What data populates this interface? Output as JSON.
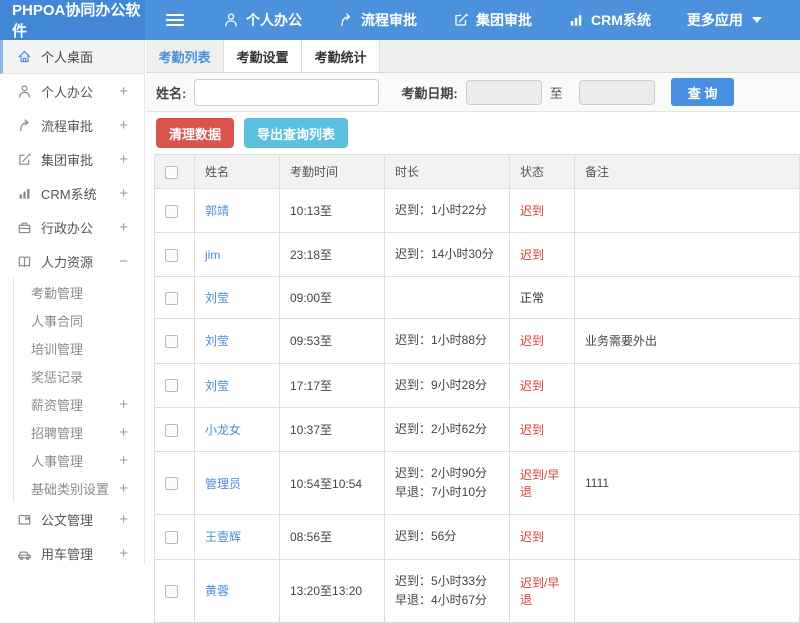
{
  "header": {
    "logo": "PHPOA协同办公软件",
    "nav": [
      {
        "label": "个人办公",
        "icon": "person-icon"
      },
      {
        "label": "流程审批",
        "icon": "flow-icon"
      },
      {
        "label": "集团审批",
        "icon": "edit-icon"
      },
      {
        "label": "CRM系统",
        "icon": "chart-icon"
      },
      {
        "label": "更多应用",
        "icon": "caret-down-icon"
      }
    ]
  },
  "sidebar": {
    "items": [
      {
        "label": "个人桌面",
        "icon": "home-icon",
        "active": true,
        "expand": ""
      },
      {
        "label": "个人办公",
        "icon": "person-icon",
        "expand": "+"
      },
      {
        "label": "流程审批",
        "icon": "flow-icon",
        "expand": "+"
      },
      {
        "label": "集团审批",
        "icon": "edit-icon",
        "expand": "+"
      },
      {
        "label": "CRM系统",
        "icon": "chart-icon",
        "expand": "+"
      },
      {
        "label": "行政办公",
        "icon": "briefcase-icon",
        "expand": "+"
      },
      {
        "label": "人力资源",
        "icon": "book-icon",
        "expand": "−"
      }
    ],
    "submenu": [
      {
        "label": "考勤管理",
        "expand": ""
      },
      {
        "label": "人事合同",
        "expand": ""
      },
      {
        "label": "培训管理",
        "expand": ""
      },
      {
        "label": "奖惩记录",
        "expand": ""
      },
      {
        "label": "薪资管理",
        "expand": "+"
      },
      {
        "label": "招聘管理",
        "expand": "+"
      },
      {
        "label": "人事管理",
        "expand": "+"
      },
      {
        "label": "基础类别设置",
        "expand": "+"
      }
    ],
    "bottom": [
      {
        "label": "公文管理",
        "icon": "document-icon",
        "expand": "+"
      },
      {
        "label": "用车管理",
        "icon": "car-icon",
        "expand": "+"
      }
    ]
  },
  "tabs": [
    {
      "label": "考勤列表",
      "active": true
    },
    {
      "label": "考勤设置",
      "active": false
    },
    {
      "label": "考勤统计",
      "active": false
    }
  ],
  "filter": {
    "name_label": "姓名:",
    "name_value": "",
    "date_label": "考勤日期:",
    "date_from_value": "",
    "to_label": "至",
    "date_to_value": "",
    "search_button": "查 询"
  },
  "actions": {
    "clean_button": "清理数据",
    "export_button": "导出查询列表"
  },
  "colors": {
    "topbar_blue": "#4b91dc",
    "accent_blue": "#4a90d9",
    "search_blue": "#4a90e2",
    "danger_red": "#d9534f",
    "export_cyan": "#5bc0de",
    "late_red": "#d6413d",
    "normal_dark": "#333333"
  },
  "table": {
    "headers": {
      "name": "姓名",
      "time": "考勤时间",
      "duration": "时长",
      "status": "状态",
      "note": "备注"
    },
    "rows": [
      {
        "name": "郭靖",
        "time": "10:13至",
        "duration": "迟到：1小时22分",
        "status": "迟到",
        "status_color": "#d6413d",
        "note": ""
      },
      {
        "name": "jim",
        "time": "23:18至",
        "duration": "迟到：14小时30分",
        "status": "迟到",
        "status_color": "#d6413d",
        "note": ""
      },
      {
        "name": "刘莹",
        "time": "09:00至",
        "duration": "",
        "status": "正常",
        "status_color": "#333333",
        "note": ""
      },
      {
        "name": "刘莹",
        "time": "09:53至",
        "duration": "迟到：1小时88分",
        "status": "迟到",
        "status_color": "#d6413d",
        "note": "业务需要外出"
      },
      {
        "name": "刘莹",
        "time": "17:17至",
        "duration": "迟到：9小时28分",
        "status": "迟到",
        "status_color": "#d6413d",
        "note": ""
      },
      {
        "name": "小龙女",
        "time": "10:37至",
        "duration": "迟到：2小时62分",
        "status": "迟到",
        "status_color": "#d6413d",
        "note": ""
      },
      {
        "name": "管理员",
        "time": "10:54至10:54",
        "duration": "迟到：2小时90分\n早退：7小时10分",
        "status": "迟到/早退",
        "status_color": "#d6413d",
        "note": "1111"
      },
      {
        "name": "王壹辉",
        "time": "08:56至",
        "duration": "迟到：56分",
        "status": "迟到",
        "status_color": "#d6413d",
        "note": ""
      },
      {
        "name": "黄蓉",
        "time": "13:20至13:20",
        "duration": "迟到：5小时33分\n早退：4小时67分",
        "status": "迟到/早退",
        "status_color": "#d6413d",
        "note": ""
      }
    ]
  }
}
